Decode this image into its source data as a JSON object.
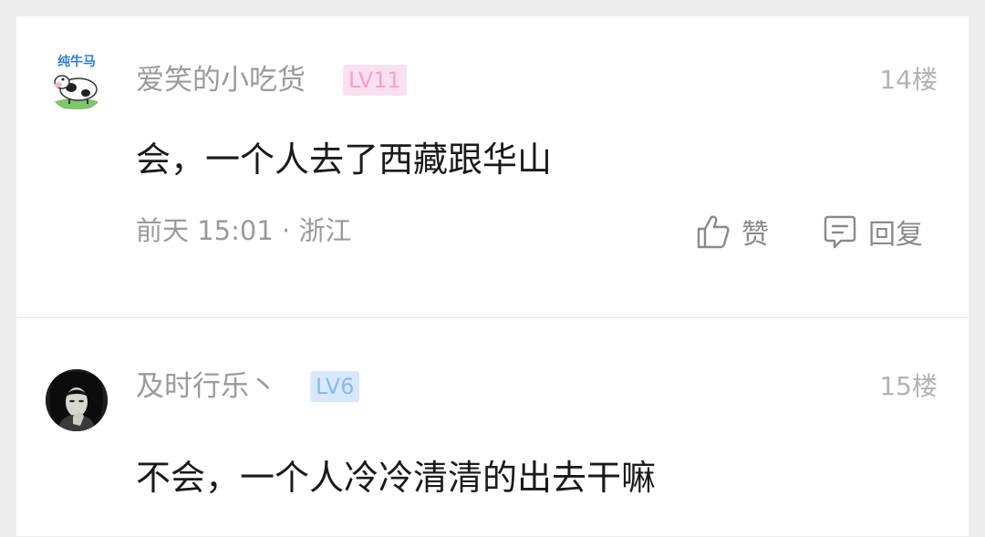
{
  "comments": [
    {
      "avatar_text": "纯牛马",
      "username": "爱笑的小吃货",
      "level": "LV11",
      "floor": "14楼",
      "content": "会，一个人去了西藏跟华山",
      "time": "前天 15:01",
      "location": "浙江",
      "like_label": "赞",
      "reply_label": "回复"
    },
    {
      "username": "及时行乐丶",
      "level": "LV6",
      "floor": "15楼",
      "content": "不会，一个人冷冷清清的出去干嘛"
    }
  ]
}
